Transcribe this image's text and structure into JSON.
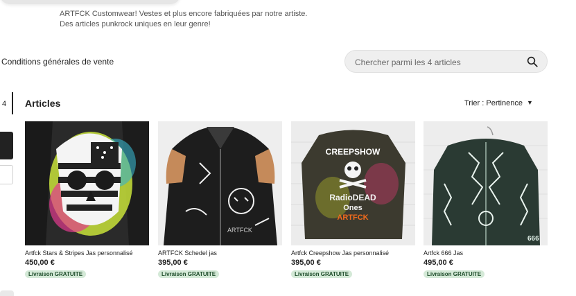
{
  "shop": {
    "description_line1": "ARTFCK Customwear! Vestes et plus encore fabriquées par notre artiste.",
    "description_line2": "Des articles punkrock uniques en leur genre!"
  },
  "links": {
    "conditions": "Conditions générales de vente"
  },
  "search": {
    "placeholder": "Chercher parmi les 4 articles"
  },
  "section": {
    "count": "4",
    "heading": "Articles",
    "sort_label": "Trier : Pertinence"
  },
  "products": [
    {
      "title": "Artfck Stars & Stripes Jas personnalisé",
      "price": "450,00 €",
      "badge": "Livraison GRATUITE"
    },
    {
      "title": "ARTFCK Schedel jas",
      "price": "395,00 €",
      "badge": "Livraison GRATUITE"
    },
    {
      "title": "Artfck Creepshow Jas personnalisé",
      "price": "395,00 €",
      "badge": "Livraison GRATUITE"
    },
    {
      "title": "Artfck 666 Jas",
      "price": "495,00 €",
      "badge": "Livraison GRATUITE"
    }
  ],
  "colors": {
    "badge_bg": "#d4e9d7",
    "badge_text": "#1e4d2b",
    "search_bg": "#efefef"
  },
  "icons": {
    "search": "search-icon",
    "sort": "chevron-down-icon"
  }
}
